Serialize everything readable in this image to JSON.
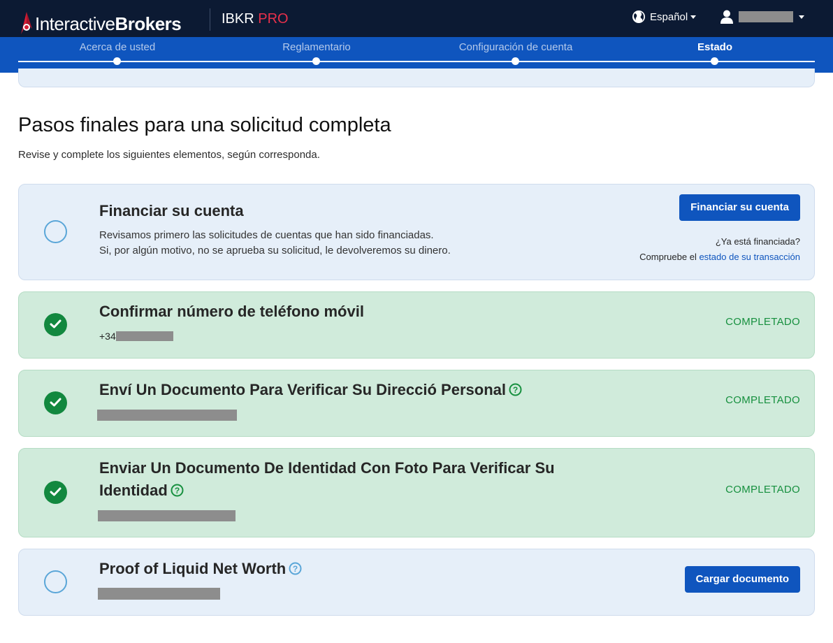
{
  "header": {
    "brand_regular": "Interactive",
    "brand_bold": "Brokers",
    "product_name": "IBKR",
    "product_tier": "PRO",
    "language": "Español"
  },
  "stepper": {
    "steps": [
      {
        "label": "Acerca de usted"
      },
      {
        "label": "Reglamentario"
      },
      {
        "label": "Configuración de cuenta"
      },
      {
        "label": "Estado"
      }
    ],
    "active_index": 3
  },
  "page": {
    "title": "Pasos finales para una solicitud completa",
    "subtitle": "Revise y complete los siguientes elementos, según corresponda."
  },
  "tasks": {
    "fund": {
      "title": "Financiar su cuenta",
      "desc_line1": "Revisamos primero las solicitudes de cuentas que han sido financiadas.",
      "desc_line2": "Si, por algún motivo, no se aprueba su solicitud, le devolveremos su dinero.",
      "button": "Financiar su cuenta",
      "already_funded": "¿Ya está financiada?",
      "check_prefix": "Compruebe el",
      "check_link": "estado de su transacción",
      "status": "pending"
    },
    "phone": {
      "title": "Confirmar número de teléfono móvil",
      "phone_prefix": "+34",
      "status_label": "COMPLETADO"
    },
    "address": {
      "title": "Enví Un Documento Para Verificar Su Direcció Personal",
      "status_label": "COMPLETADO"
    },
    "identity": {
      "title_line1": "Enviar Un Documento De Identidad Con Foto Para Verificar Su",
      "title_line2": "Identidad",
      "status_label": "COMPLETADO"
    },
    "networth": {
      "title": "Proof of Liquid Net Worth",
      "button": "Cargar documento",
      "status": "pending"
    }
  },
  "colors": {
    "header_bg": "#0c1a33",
    "stepper_bg": "#0f55be",
    "accent_red": "#e8304b",
    "pending_card": "#e6eff9",
    "done_card": "#d0ebdb",
    "success_green": "#12883f"
  },
  "icons": [
    "globe-icon",
    "user-icon",
    "check-icon",
    "help-icon",
    "chevron-down-icon"
  ]
}
